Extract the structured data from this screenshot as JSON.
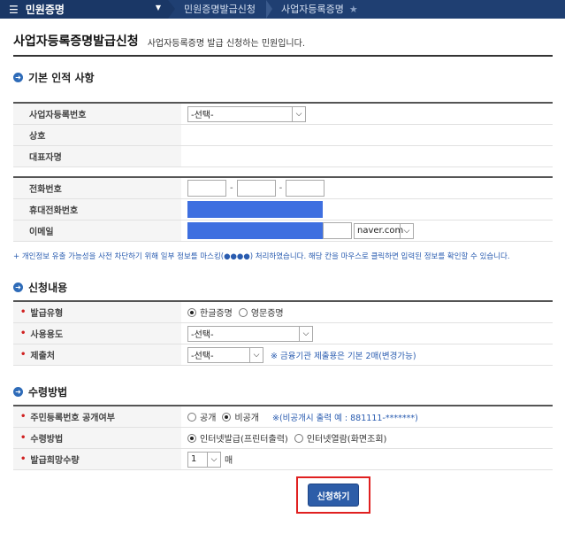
{
  "nav": {
    "menu_label": "민원증명",
    "crumbs": [
      "민원증명발급신청",
      "사업자등록증명"
    ]
  },
  "page": {
    "title": "사업자등록증명발급신청",
    "subtitle": "사업자등록증명 발급 신청하는 민원입니다."
  },
  "section_basic": {
    "title": "기본 인적 사항",
    "biz_no_label": "사업자등록번호",
    "biz_no_value": "-선택-",
    "company_label": "상호",
    "ceo_label": "대표자명",
    "phone_label": "전화번호",
    "mobile_label": "휴대전화번호",
    "email_label": "이메일",
    "email_domain": "naver.com",
    "dash": "-"
  },
  "notice": "+ 개인정보 유출 가능성을 사전 차단하기 위해 일부 정보를 마스킹(●●●●) 처리하였습니다. 해당 칸을 마우스로 클릭하면 입력된 정보를 확인할 수 있습니다.",
  "section_apply": {
    "title": "신청내용",
    "type_label": "발급유형",
    "type_options": [
      "한글증명",
      "영문증명"
    ],
    "use_label": "사용용도",
    "use_value": "-선택-",
    "submit_label": "제출처",
    "submit_value": "-선택-",
    "submit_hint": "※ 금융기관 제출용은 기본 2매(변경가능)"
  },
  "section_receive": {
    "title": "수령방법",
    "rrn_label": "주민등록번호 공개여부",
    "rrn_options": [
      "공개",
      "비공개"
    ],
    "rrn_hint": "※(비공개시 출력 예 : 881111-*******)",
    "method_label": "수령방법",
    "method_options": [
      "인터넷발급(프린터출력)",
      "인터넷열람(화면조회)"
    ],
    "qty_label": "발급희망수량",
    "qty_value": "1",
    "qty_unit": "매"
  },
  "actions": {
    "apply_label": "신청하기"
  },
  "colors": {
    "nav_bg": "#1f3f72",
    "accent_blue": "#2d5da8",
    "highlight_red": "#e02020",
    "mask_fill": "#3e6fe0"
  }
}
